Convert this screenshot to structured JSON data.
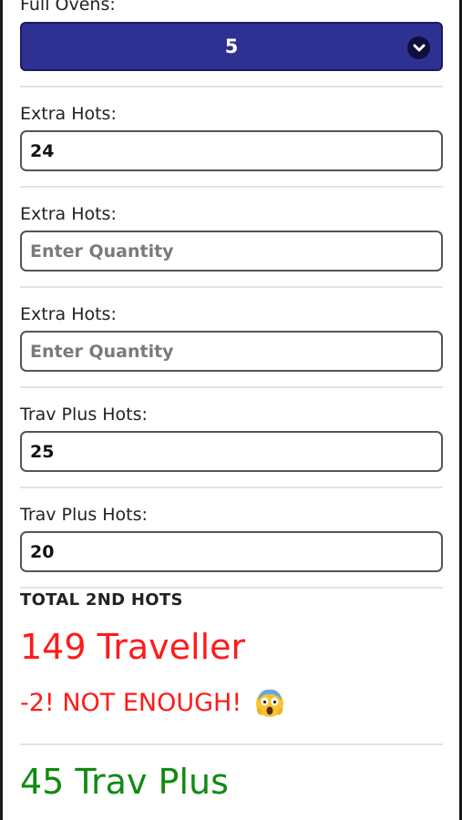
{
  "oven": {
    "label": "Full Ovens:",
    "selected": "5"
  },
  "fields": [
    {
      "label": "Extra Hots:",
      "value": "24",
      "placeholder": "Enter Quantity"
    },
    {
      "label": "Extra Hots:",
      "value": "",
      "placeholder": "Enter Quantity"
    },
    {
      "label": "Extra Hots:",
      "value": "",
      "placeholder": "Enter Quantity"
    },
    {
      "label": "Trav Plus Hots:",
      "value": "25",
      "placeholder": "Enter Quantity"
    },
    {
      "label": "Trav Plus Hots:",
      "value": "20",
      "placeholder": "Enter Quantity"
    }
  ],
  "totals": {
    "title": "TOTAL 2ND HOTS",
    "traveller": "149 Traveller",
    "warning": "-2! NOT ENOUGH!",
    "warning_emoji": "screaming-face-icon",
    "trav_plus": "45 Trav Plus"
  },
  "colors": {
    "select_bg": "#2e3192",
    "warning_red": "#ff1a1a",
    "ok_green": "#118a11"
  }
}
